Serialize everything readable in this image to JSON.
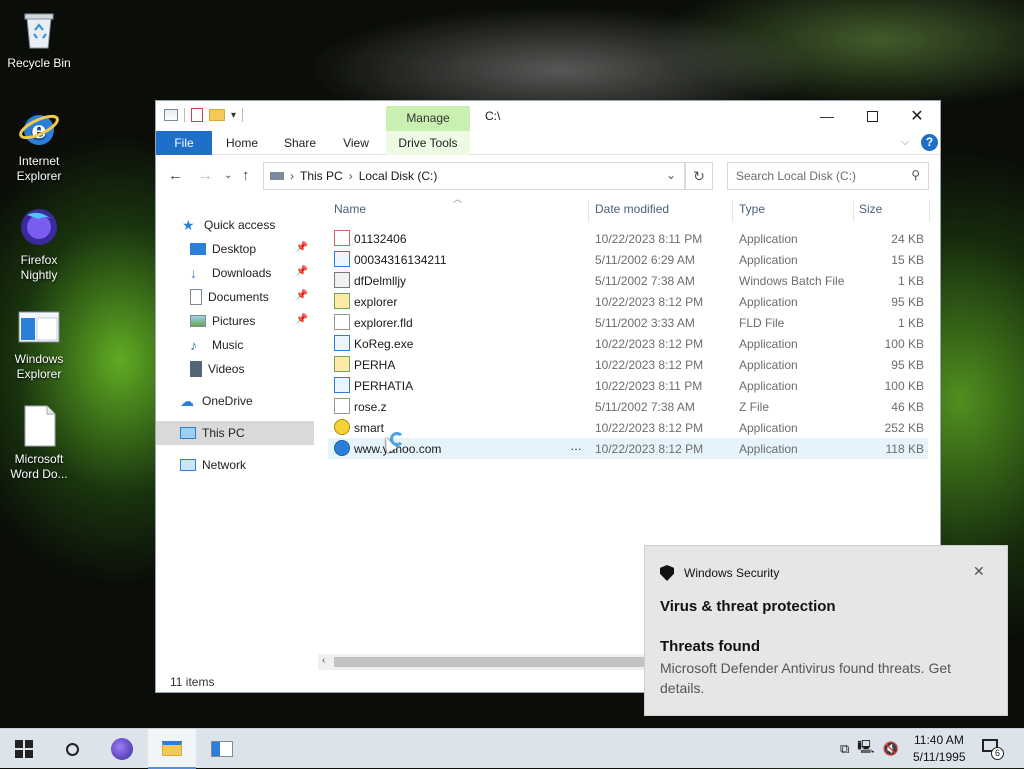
{
  "desktop": {
    "icons": [
      {
        "label": "Recycle Bin"
      },
      {
        "label": "Internet Explorer"
      },
      {
        "label": "Firefox Nightly"
      },
      {
        "label": "Windows Explorer"
      },
      {
        "label": "Microsoft Word Do..."
      }
    ]
  },
  "explorer": {
    "title_path": "C:\\",
    "manage_tab": "Manage",
    "ribbon_tabs": [
      "File",
      "Home",
      "Share",
      "View",
      "Drive Tools"
    ],
    "breadcrumb": [
      "This PC",
      "Local Disk (C:)"
    ],
    "search_placeholder": "Search Local Disk (C:)",
    "nav": {
      "quick_access": "Quick access",
      "items": [
        "Desktop",
        "Downloads",
        "Documents",
        "Pictures",
        "Music",
        "Videos"
      ],
      "onedrive": "OneDrive",
      "this_pc": "This PC",
      "network": "Network"
    },
    "columns": [
      "Name",
      "Date modified",
      "Type",
      "Size"
    ],
    "files": [
      {
        "name": "01132406",
        "date": "10/22/2023 8:11 PM",
        "type": "Application",
        "size": "24 KB"
      },
      {
        "name": "00034316134211",
        "date": "5/11/2002 6:29 AM",
        "type": "Application",
        "size": "15 KB"
      },
      {
        "name": "dfDelmlljy",
        "date": "5/11/2002 7:38 AM",
        "type": "Windows Batch File",
        "size": "1 KB"
      },
      {
        "name": "explorer",
        "date": "10/22/2023 8:12 PM",
        "type": "Application",
        "size": "95 KB"
      },
      {
        "name": "explorer.fld",
        "date": "5/11/2002 3:33 AM",
        "type": "FLD File",
        "size": "1 KB"
      },
      {
        "name": "KoReg.exe",
        "date": "10/22/2023 8:12 PM",
        "type": "Application",
        "size": "100 KB"
      },
      {
        "name": "PERHA",
        "date": "10/22/2023 8:12 PM",
        "type": "Application",
        "size": "95 KB"
      },
      {
        "name": "PERHATIA",
        "date": "10/22/2023 8:11 PM",
        "type": "Application",
        "size": "100 KB"
      },
      {
        "name": "rose.z",
        "date": "5/11/2002 7:38 AM",
        "type": "Z File",
        "size": "46 KB"
      },
      {
        "name": "smart",
        "date": "10/22/2023 8:12 PM",
        "type": "Application",
        "size": "252 KB"
      },
      {
        "name": "www.yahoo.com",
        "date": "10/22/2023 8:12 PM",
        "type": "Application",
        "size": "118 KB"
      }
    ],
    "status": "11 items"
  },
  "toast": {
    "app": "Windows Security",
    "heading": "Virus & threat protection",
    "subheading": "Threats found",
    "body": "Microsoft Defender Antivirus found threats. Get details."
  },
  "taskbar": {
    "time": "11:40 AM",
    "date": "5/11/1995",
    "notification_count": "6"
  }
}
